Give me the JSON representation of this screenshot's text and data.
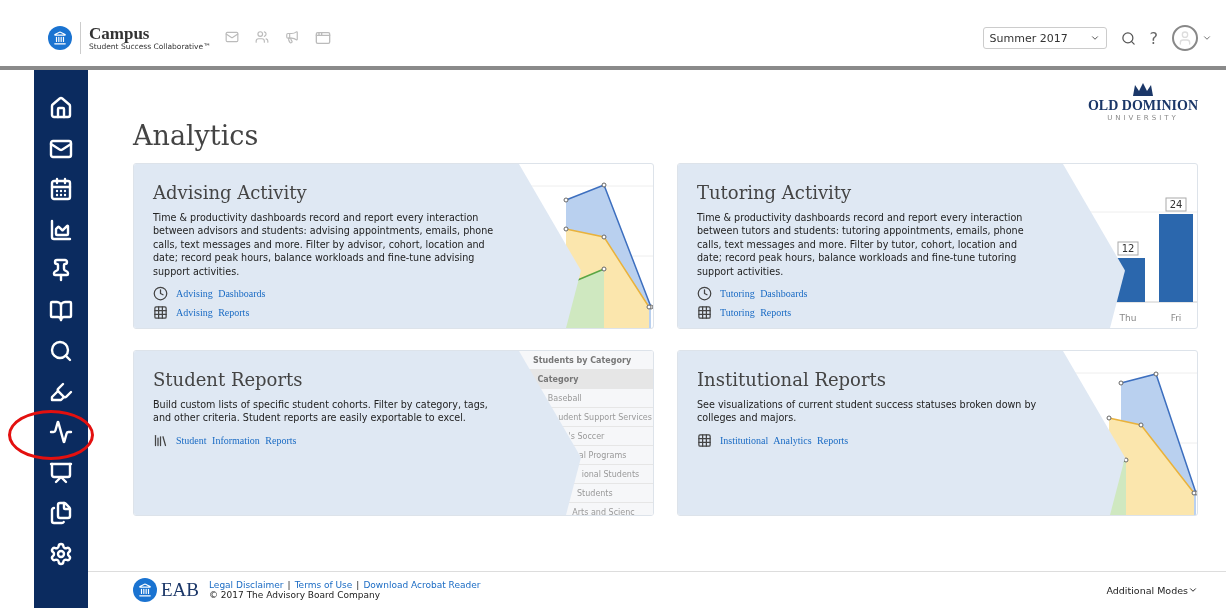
{
  "header": {
    "brand": "Campus",
    "tagline": "Student Success Collaborative™",
    "term": "Summer 2017",
    "help": "?"
  },
  "page": {
    "title": "Analytics",
    "university": "OLD DOMINION",
    "university_sub": "UNIVERSITY"
  },
  "cards": [
    {
      "kind": "lines",
      "title": "Advising Activity",
      "description": "Time & productivity dashboards record and report every interaction between advisors and students: advising appointments, emails, phone calls, text messages and more. Filter by advisor, cohort, location and date; record peak hours, balance workloads and fine-tune advising support activities.",
      "links": [
        {
          "kind": "dashboard",
          "label": "Advising Dashboards"
        },
        {
          "kind": "report",
          "label": "Advising Reports"
        }
      ]
    },
    {
      "kind": "bars",
      "title": "Tutoring Activity",
      "description": "Time & productivity dashboards record and report every interaction between tutors and students: tutoring appointments, emails, phone calls, text messages and more. Filter by tutor, cohort, location and date; record peak hours, balance workloads and fine-tune tutoring support activities.",
      "links": [
        {
          "kind": "dashboard",
          "label": "Tutoring Dashboards"
        },
        {
          "kind": "report",
          "label": "Tutoring Reports"
        }
      ],
      "chart_data": {
        "type": "bar",
        "categories": [
          "Thu",
          "Fri"
        ],
        "values": [
          12,
          24
        ],
        "data_labels": true
      }
    },
    {
      "kind": "list",
      "title": "Student Reports",
      "description": "Build custom lists of specific student cohorts. Filter by category, tags, and other criteria. Student reports are easily exportable to excel.",
      "links": [
        {
          "kind": "students",
          "label": "Student Information Reports"
        }
      ],
      "preview_rows": [
        {
          "text": "Students by Category",
          "kind": "title"
        },
        {
          "text": "Category",
          "kind": "head"
        },
        {
          "text": "Baseball",
          "kind": "row"
        },
        {
          "text": "udent Support Services",
          "kind": "row"
        },
        {
          "text": "'s Soccer",
          "kind": "row"
        },
        {
          "text": "al Programs",
          "kind": "row"
        },
        {
          "text": "ional Students",
          "kind": "row"
        },
        {
          "text": "Students",
          "kind": "row"
        },
        {
          "text": "Arts and Scienc",
          "kind": "row"
        }
      ]
    },
    {
      "kind": "lines",
      "title": "Institutional Reports",
      "description": "See visualizations of current student success statuses broken down by colleges and majors.",
      "links": [
        {
          "kind": "report",
          "label": "Institutional Analytics Reports"
        }
      ]
    }
  ],
  "footer": {
    "logo": "EAB",
    "links": [
      "Legal Disclaimer",
      "Terms of Use",
      "Download Acrobat Reader"
    ],
    "separator": "|",
    "copyright": "© 2017 The Advisory Board Company",
    "modes": "Additional Modes"
  }
}
